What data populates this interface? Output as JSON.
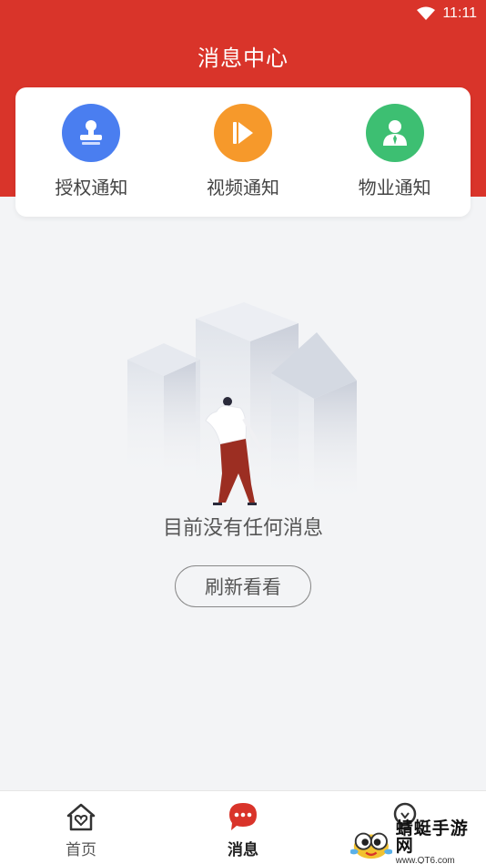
{
  "status_bar": {
    "time": "11:11",
    "wifi_icon": "wifi-icon"
  },
  "header": {
    "title": "消息中心",
    "bg_color": "#d9342a"
  },
  "categories": [
    {
      "label": "授权通知",
      "icon": "stamp-icon",
      "color": "#4a7ef0"
    },
    {
      "label": "视频通知",
      "icon": "play-icon",
      "color": "#f6992b"
    },
    {
      "label": "物业通知",
      "icon": "staff-icon",
      "color": "#3dbf72"
    }
  ],
  "empty_state": {
    "message": "目前没有任何消息",
    "refresh_label": "刷新看看"
  },
  "bottom_nav": [
    {
      "label": "首页",
      "icon": "home-heart-icon",
      "active": false
    },
    {
      "label": "消息",
      "icon": "chat-bubble-icon",
      "active": true
    },
    {
      "label": "",
      "icon": "lightbulb-icon",
      "active": false
    }
  ],
  "watermark": {
    "title": "蜻蜓手游网",
    "url": "www.QT6.com"
  }
}
